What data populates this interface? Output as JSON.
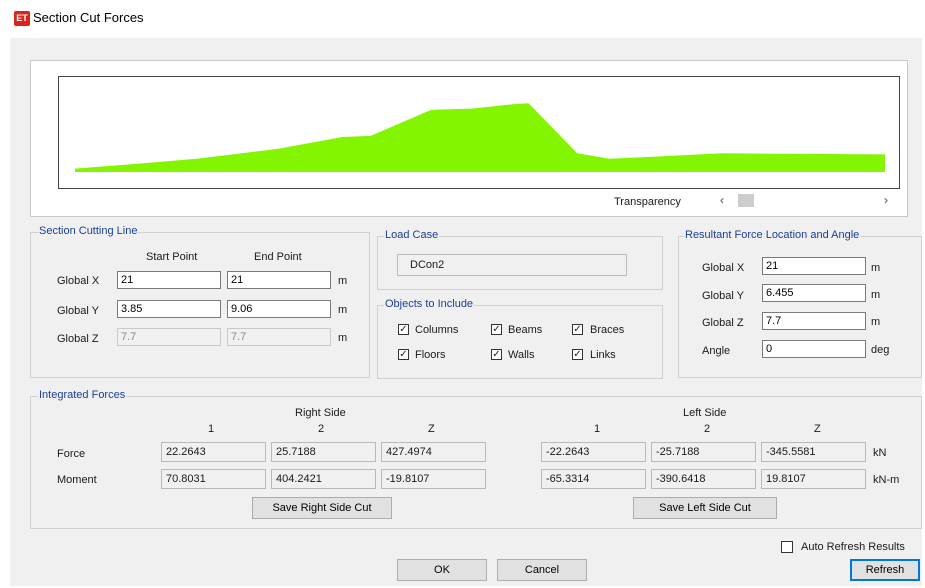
{
  "window": {
    "title": "Section Cut Forces",
    "app_icon": "ET"
  },
  "plot": {
    "fill_color": "#84f500",
    "profile": [
      [
        0,
        60
      ],
      [
        0.07,
        0.55
      ],
      [
        0.15,
        0.5
      ],
      [
        0.25,
        0.4
      ],
      [
        0.33,
        0.3
      ],
      [
        0.365,
        0.3
      ],
      [
        0.44,
        0.2
      ],
      [
        0.49,
        0.2
      ],
      [
        0.54,
        0.12
      ],
      [
        0.56,
        0.1
      ],
      [
        0.62,
        0.4
      ],
      [
        0.66,
        0.47
      ],
      [
        0.8,
        0.42
      ],
      [
        1,
        0.44
      ]
    ],
    "transparency_label": "Transparency"
  },
  "section_cutting_line": {
    "title": "Section Cutting Line",
    "start_header": "Start Point",
    "end_header": "End Point",
    "rows": [
      {
        "label": "Global  X",
        "start": "21",
        "end": "21",
        "unit": "m"
      },
      {
        "label": "Global  Y",
        "start": "3.85",
        "end": "9.06",
        "unit": "m"
      },
      {
        "label": "Global  Z",
        "start": "7.7",
        "end": "7.7",
        "unit": "m"
      }
    ]
  },
  "load_case": {
    "title": "Load Case",
    "value": "DCon2"
  },
  "objects": {
    "title": "Objects to Include",
    "items": [
      {
        "label": "Columns",
        "checked": true
      },
      {
        "label": "Beams",
        "checked": true
      },
      {
        "label": "Braces",
        "checked": true
      },
      {
        "label": "Floors",
        "checked": true
      },
      {
        "label": "Walls",
        "checked": true
      },
      {
        "label": "Links",
        "checked": true
      }
    ],
    "check_mark": "✓"
  },
  "resultant": {
    "title": "Resultant Force Location and Angle",
    "rows": [
      {
        "label": "Global  X",
        "value": "21",
        "unit": "m"
      },
      {
        "label": "Global  Y",
        "value": "6.455",
        "unit": "m"
      },
      {
        "label": "Global  Z",
        "value": "7.7",
        "unit": "m"
      },
      {
        "label": "Angle",
        "value": "0",
        "unit": "deg"
      }
    ]
  },
  "integrated": {
    "title": "Integrated Forces",
    "right_side": "Right Side",
    "left_side": "Left Side",
    "col_headers": [
      "1",
      "2",
      "Z"
    ],
    "rows": [
      {
        "label": "Force",
        "right": [
          "22.2643",
          "25.7188",
          "427.4974"
        ],
        "left": [
          "-22.2643",
          "-25.7188",
          "-345.5581"
        ],
        "unit": "kN"
      },
      {
        "label": "Moment",
        "right": [
          "70.8031",
          "404.2421",
          "-19.8107"
        ],
        "left": [
          "-65.3314",
          "-390.6418",
          "19.8107"
        ],
        "unit": "kN-m"
      }
    ],
    "save_right": "Save Right Side Cut",
    "save_left": "Save Left Side Cut"
  },
  "footer": {
    "auto_refresh": "Auto Refresh Results",
    "ok": "OK",
    "cancel": "Cancel",
    "refresh": "Refresh"
  },
  "icons": {
    "scroll_left": "‹",
    "scroll_right": "›"
  }
}
